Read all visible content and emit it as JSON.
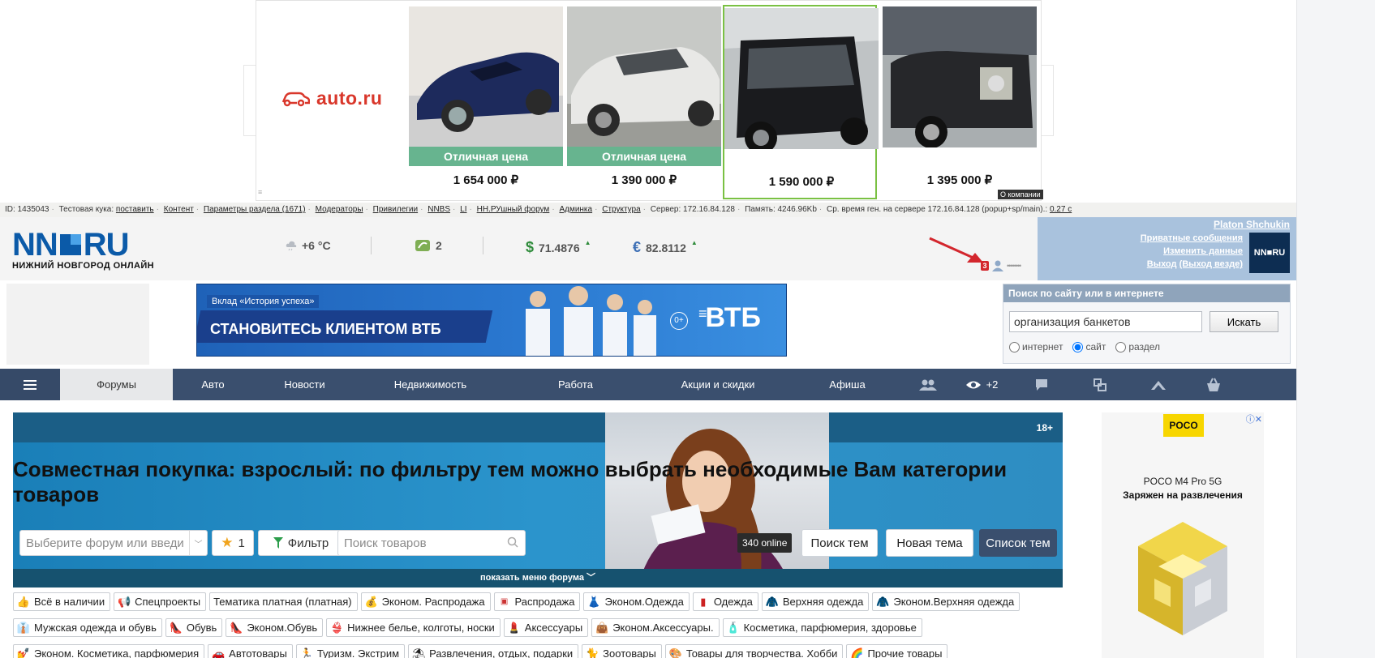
{
  "top_ad": {
    "brand": "auto.ru",
    "cars": [
      {
        "badge": "Отличная цена",
        "price": "1 654 000 ₽"
      },
      {
        "badge": "Отличная цена",
        "price": "1 390 000 ₽"
      },
      {
        "badge": "",
        "price": "1 590 000 ₽"
      },
      {
        "badge": "",
        "price": "1 395 000 ₽"
      }
    ],
    "about_label": "О компании"
  },
  "debug": {
    "id": "ID: 1435043",
    "test_cookie": "Тестовая кука:",
    "set": "поставить",
    "content": "Контент",
    "params": "Параметры раздела (1671)",
    "moderators": "Модераторы",
    "privileges": "Привилегии",
    "nnbs": "NNBS",
    "li": "LI",
    "nn_forum": "НН.РУшный форум",
    "admin": "Админка",
    "structure": "Структура",
    "server": "Сервер: 172.16.84.128",
    "memory": "Память: 4246.96Kb",
    "gen_time": "Ср. время ген. на сервере 172.16.84.128 (popup+sp/main).:",
    "gen_val": "0.27 с"
  },
  "header": {
    "logo_left": "NN",
    "logo_right": "RU",
    "logo_sub": "НИЖНИЙ НОВГОРОД ОНЛАЙН",
    "weather": "+6 °C",
    "traffic": "2",
    "usd": "71.4876",
    "eur": "82.8112",
    "notif_count": "3",
    "user": {
      "name": "Platon Shchukin",
      "messages": "Приватные сообщения",
      "edit": "Изменить данные",
      "logout": "Выход",
      "logout_all": "(Выход везде)",
      "avatar": "NN■RU"
    }
  },
  "vtb_banner": {
    "tag": "Вклад «История успеха»",
    "title": "СТАНОВИТЕСЬ КЛИЕНТОМ ВТБ",
    "age": "0+",
    "brand": "ВТБ"
  },
  "search": {
    "title": "Поиск по сайту или в интернете",
    "value": "организация банкетов",
    "button": "Искать",
    "options": [
      "интернет",
      "сайт",
      "раздел"
    ],
    "selected": "сайт"
  },
  "nav": {
    "items": [
      "Форумы",
      "Авто",
      "Новости",
      "Недвижимость",
      "Работа",
      "Акции и скидки",
      "Афиша"
    ],
    "active": "Форумы",
    "eye_count": "+2"
  },
  "forum_banner": {
    "age": "18+",
    "title": "Совместная покупка: взрослый: по фильтру тем можно выбрать необходимые Вам категории товаров",
    "forum_select_placeholder": "Выберите форум или введи",
    "fav_count": "1",
    "filter": "Фильтр",
    "goods_search_placeholder": "Поиск товаров",
    "online": "340 online",
    "search_topics": "Поиск тем",
    "new_topic": "Новая тема",
    "topic_list": "Список тем",
    "show_menu": "показать меню форума"
  },
  "side_ad": {
    "brand": "POCO",
    "line1": "POCO M4 Pro 5G",
    "line2": "Заряжен на развлечения"
  },
  "categories": [
    [
      "Всё в наличии",
      "Спецпроекты",
      "Тематика платная (платная)",
      "Эконом. Распродажа",
      "Распродажа",
      "Эконом.Одежда",
      "Одежда",
      "Верхняя одежда",
      "Эконом.Верхняя одежда"
    ],
    [
      "Мужская одежда и обувь",
      "Обувь",
      "Эконом.Обувь",
      "Нижнее белье, колготы, носки",
      "Аксессуары",
      "Эконом.Аксессуары.",
      "Косметика, парфюмерия, здоровье"
    ],
    [
      "Эконом. Косметика, парфюмерия",
      "Автотовары",
      "Туризм. Экстрим",
      "Развлечения, отдых, подарки",
      "Зоотовары",
      "Товары для творчества. Хобби",
      "Прочие товары"
    ]
  ],
  "colors": {
    "nav_bg": "#3a4f6e",
    "brand_blue": "#0b5aa8",
    "badge_green": "#67b48f",
    "user_box": "#a9c2dd"
  }
}
